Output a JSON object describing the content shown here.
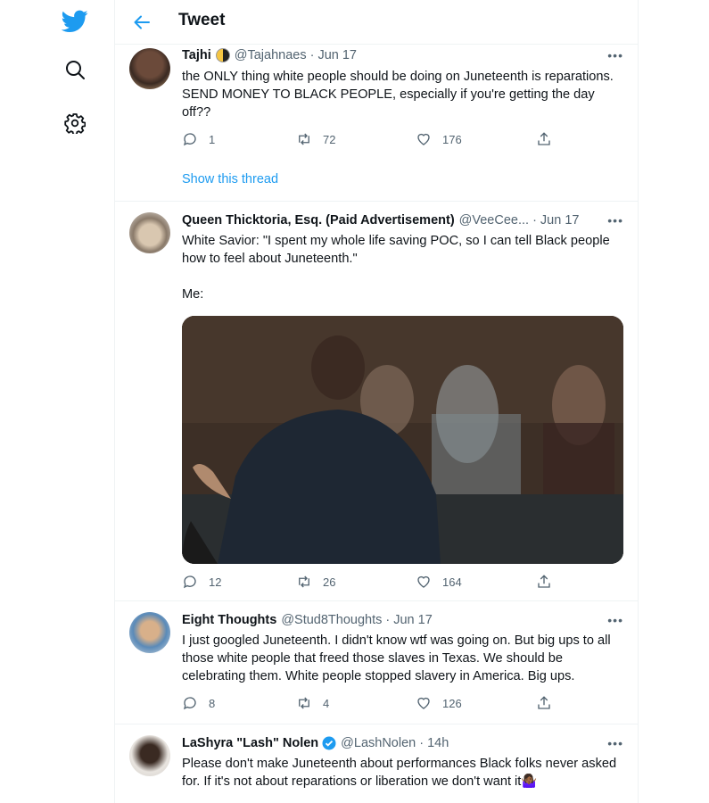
{
  "nav": {
    "logo_icon": "twitter-bird-icon",
    "search_icon": "search-icon",
    "settings_icon": "gear-icon",
    "accent": "#1d9bf0"
  },
  "header": {
    "title": "Tweet",
    "back_icon": "arrow-left-icon"
  },
  "tweets": [
    {
      "name": "Tajhi",
      "handle": "@Tajahnaes",
      "time": "Jun 17",
      "text": "the ONLY thing white people should be doing on Juneteenth is reparations. SEND MONEY TO BLACK PEOPLE, especially if you're getting the day off??",
      "replies": "1",
      "retweets": "72",
      "likes": "176",
      "show_thread": "Show this thread"
    },
    {
      "name": "Queen Thicktoria, Esq. (Paid Advertisement)",
      "handle": "@VeeCee...",
      "time": "Jun 17",
      "text": "White Savior: \"I spent my whole life saving POC, so I can tell Black people how to feel about Juneteenth.\"\n\nMe:",
      "replies": "12",
      "retweets": "26",
      "likes": "164"
    },
    {
      "name": "Eight Thoughts",
      "handle": "@Stud8Thoughts",
      "time": "Jun 17",
      "text": "I just googled Juneteenth. I didn't know wtf was going on. But big ups to all those white people that freed those slaves in Texas. We should be celebrating them. White people stopped slavery in America. Big ups.",
      "replies": "8",
      "retweets": "4",
      "likes": "126"
    },
    {
      "name": "LaShyra \"Lash\" Nolen",
      "handle": "@LashNolen",
      "time": "14h",
      "text": "Please don't make Juneteenth about performances Black folks never asked for. If it's not about reparations or liberation we don't want it🤷🏾‍♀️"
    }
  ],
  "more_label": "•••",
  "separator": "·"
}
